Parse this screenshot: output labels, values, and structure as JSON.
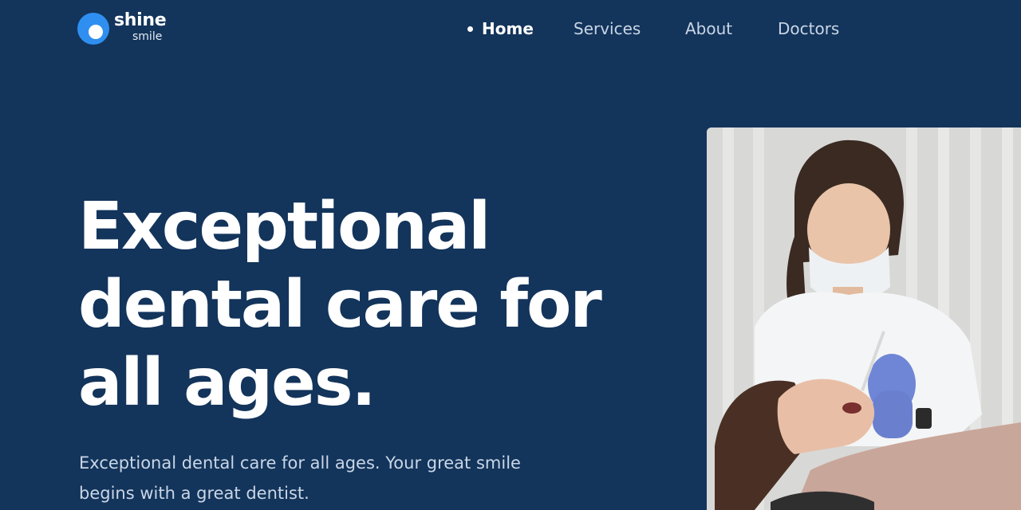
{
  "brand": {
    "name": "shine",
    "tagline": "smile",
    "logo_icon": "circle-logo-icon",
    "accent_color": "#2f8ff0"
  },
  "nav": {
    "items": [
      {
        "label": "Home",
        "active": true
      },
      {
        "label": "Services",
        "active": false
      },
      {
        "label": "About",
        "active": false
      },
      {
        "label": "Doctors",
        "active": false
      }
    ]
  },
  "hero": {
    "title": "Exceptional dental care for all ages.",
    "subtitle": "Exceptional dental care for all ages. Your great smile begins with a great dentist."
  },
  "colors": {
    "background": "#13345b",
    "text": "#ffffff",
    "muted_text": "#c9d6e6"
  }
}
